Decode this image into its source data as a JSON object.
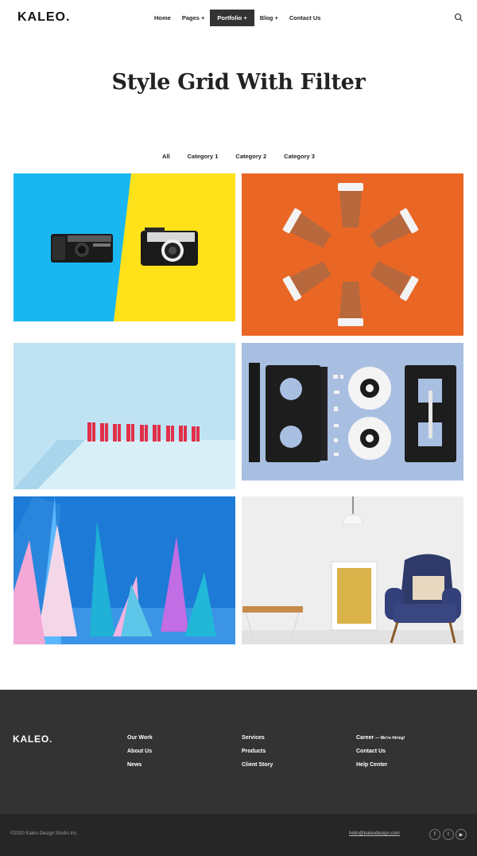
{
  "header": {
    "logo": "KALEO.",
    "nav": [
      {
        "label": "Home"
      },
      {
        "label": "Pages +"
      },
      {
        "label": "Portfolio +"
      },
      {
        "label": "Blog +"
      },
      {
        "label": "Contact Us"
      }
    ],
    "active_nav": "Portfolio +",
    "search_icon": "search-icon"
  },
  "page": {
    "title": "Style Grid With Filter"
  },
  "filters": [
    {
      "label": "All"
    },
    {
      "label": "Category 1"
    },
    {
      "label": "Category 2"
    },
    {
      "label": "Category 3"
    }
  ],
  "grid": {
    "items": [
      {
        "image": "two-cameras-blue-yellow"
      },
      {
        "image": "paper-cups-orange"
      },
      {
        "image": "red-clothespins-blue"
      },
      {
        "image": "disassembled-videotape"
      },
      {
        "image": "paper-cones-blue"
      },
      {
        "image": "armchair-interior"
      }
    ]
  },
  "footer": {
    "logo": "KALEO.",
    "columns": [
      [
        "Our Work",
        "About Us",
        "News"
      ],
      [
        "Services",
        "Products",
        "Client Story"
      ],
      [
        "Career",
        "Contact Us",
        "Help Center"
      ]
    ],
    "career_note": "— We're Hiring!",
    "copyright": "©2020 Kaleo Design Studio Inc.",
    "email": "hello@kaleodesign.com",
    "social": [
      "facebook-icon",
      "twitter-icon",
      "youtube-icon"
    ],
    "colors": {
      "footer_bg": "#333333",
      "bottom_bg": "#262626"
    }
  }
}
